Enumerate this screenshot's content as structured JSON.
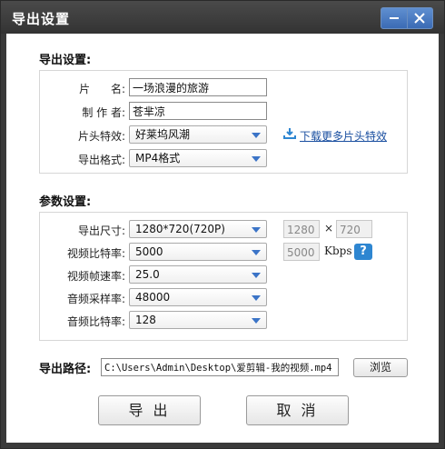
{
  "window": {
    "title": "导出设置"
  },
  "section1": {
    "title": "导出设置:",
    "name_label": "片      名:",
    "name_value": "一场浪漫的旅游",
    "author_label": "制 作 者:",
    "author_value": "苍芈凉",
    "intro_label": "片头特效:",
    "intro_value": "好莱坞风潮",
    "download_link": "下载更多片头特效",
    "format_label": "导出格式:",
    "format_value": "MP4格式"
  },
  "section2": {
    "title": "参数设置:",
    "size_label": "导出尺寸:",
    "size_value": "1280*720(720P)",
    "width_value": "1280",
    "height_value": "720",
    "times": "×",
    "vbitrate_label": "视频比特率:",
    "vbitrate_value": "5000",
    "vbitrate_field": "5000",
    "kbps": "Kbps",
    "help": "?",
    "fps_label": "视频帧速率:",
    "fps_value": "25.0",
    "samplerate_label": "音频采样率:",
    "samplerate_value": "48000",
    "abitrate_label": "音频比特率:",
    "abitrate_value": "128"
  },
  "path": {
    "label": "导出路径:",
    "value": "C:\\Users\\Admin\\Desktop\\爱剪辑-我的视频.mp4",
    "browse": "浏览"
  },
  "buttons": {
    "export": "导 出",
    "cancel": "取 消"
  },
  "colors": {
    "titlebar": "#3a3a3a",
    "accent": "#2e86d1",
    "link": "#1a4fa0"
  }
}
